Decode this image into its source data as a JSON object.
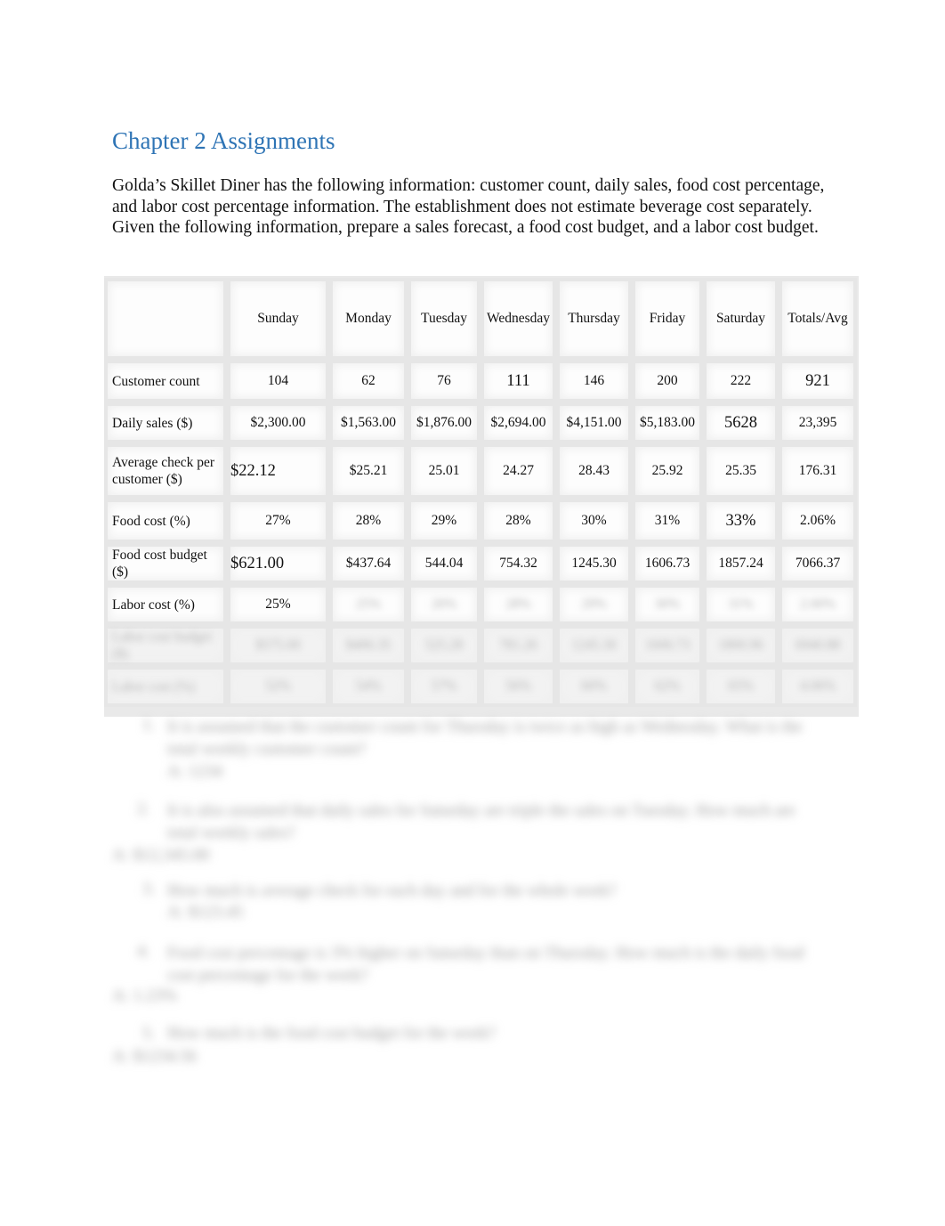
{
  "document": {
    "heading": "Chapter 2 Assignments",
    "intro": "Golda’s Skillet Diner has the following information: customer count, daily sales, food cost percentage, and labor cost percentage information. The establishment does not estimate beverage cost separately. Given the following information, prepare a sales forecast, a food cost budget, and a labor cost budget."
  },
  "table": {
    "headers": [
      "",
      "Sunday",
      "Monday",
      "Tuesday",
      "Wednesday",
      "Thursday",
      "Friday",
      "Saturday",
      "Totals/Avg"
    ],
    "rows": [
      {
        "label": "Customer count",
        "cells": [
          "104",
          "62",
          "76",
          "111",
          "146",
          "200",
          "222",
          "921"
        ]
      },
      {
        "label": "Daily sales ($)",
        "cells": [
          "$2,300.00",
          "$1,563.00",
          "$1,876.00",
          "$2,694.00",
          "$4,151.00",
          "$5,183.00",
          "5628",
          "23,395"
        ]
      },
      {
        "label": "Average check per customer ($)",
        "cells": [
          "$22.12",
          "$25.21",
          "25.01",
          "24.27",
          "28.43",
          "25.92",
          "25.35",
          "176.31"
        ]
      },
      {
        "label": "Food cost (%)",
        "cells": [
          "27%",
          "28%",
          "29%",
          "28%",
          "30%",
          "31%",
          "33%",
          "2.06%"
        ]
      },
      {
        "label": "Food cost budget ($)",
        "cells": [
          "$621.00",
          "$437.64",
          "544.04",
          "754.32",
          "1245.30",
          "1606.73",
          "1857.24",
          "7066.37"
        ]
      },
      {
        "label": "Labor cost (%)",
        "cells": [
          "25%",
          "",
          "",
          "",
          "",
          "",
          "",
          ""
        ]
      }
    ],
    "blurred_rows": [
      {
        "label": "Labor cost budget ($)",
        "cells": [
          "",
          "",
          "",
          "",
          "",
          "",
          "",
          ""
        ]
      },
      {
        "label": "Labor cost (%)",
        "cells": [
          "",
          "",
          "",
          "",
          "",
          "",
          "",
          ""
        ]
      }
    ]
  },
  "questions_blurred": [
    {
      "number": "1.",
      "text": "It is assumed that the customer count for Thursday is twice as high as Wednesday. What is the total weekly customer count?",
      "answer": "A: 1234"
    },
    {
      "number": "2.",
      "text": "It is also assumed that daily sales for Saturday are triple the sales on Tuesday. How much are total weekly sales?",
      "answer": "A: $12,345.00"
    },
    {
      "number": "3.",
      "text": "How much is average check for each day and for the whole week?",
      "answer": "A: $123.45"
    },
    {
      "number": "4.",
      "text": "Food cost percentage is 3% higher on Saturday than on Thursday. How much is the daily food cost percentage for the week?",
      "answer": "A: 1.23%"
    },
    {
      "number": "5.",
      "text": "How much is the food cost budget for the week?",
      "answer": "A: $1234.56"
    }
  ]
}
